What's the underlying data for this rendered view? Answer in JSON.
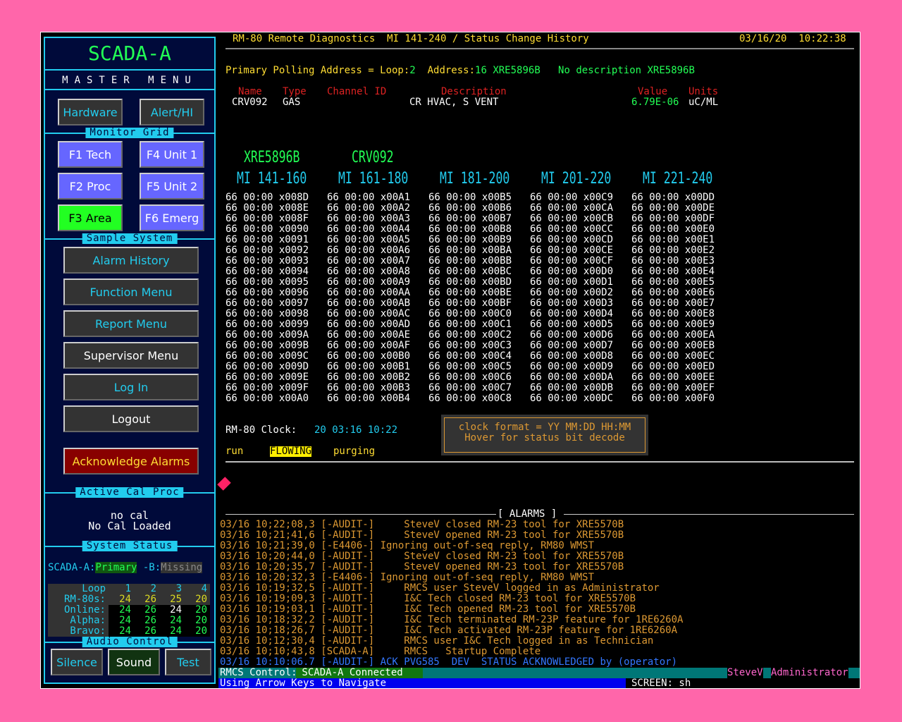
{
  "sidebar": {
    "title": "SCADA-A",
    "master_menu": "MASTER  MENU",
    "hardware": "Hardware",
    "alert": "Alert/HI",
    "monitor_grid": "Monitor Grid",
    "f1": "F1 Tech",
    "f4": "F4 Unit 1",
    "f2": "F2 Proc",
    "f5": "F5 Unit 2",
    "f3": "F3 Area",
    "f6": "F6 Emerg",
    "sample_system": "Sample System",
    "alarm_history": "Alarm History",
    "function_menu": "Function Menu",
    "report_menu": "Report Menu",
    "supervisor_menu": "Supervisor Menu",
    "log_in": "Log In",
    "logout": "Logout",
    "ack_alarms": "Acknowledge Alarms",
    "active_cal": "Active Cal Proc",
    "no_cal": "no cal",
    "no_cal_loaded": "No Cal Loaded",
    "system_status": "System  Status",
    "scada_a_label": "SCADA-A:",
    "primary": "Primary",
    "b_label": " -B:",
    "missing": "Missing",
    "status_table": {
      "header": [
        "Loop",
        "1",
        "2",
        "3",
        "4"
      ],
      "rows": [
        [
          "RM-80s:",
          "24",
          "26",
          "25",
          "20"
        ],
        [
          "Online:",
          "24",
          "26",
          "24",
          "20"
        ],
        [
          "Alpha:",
          "24",
          "26",
          "24",
          "20"
        ],
        [
          "Bravo:",
          "24",
          "26",
          "24",
          "20"
        ]
      ]
    },
    "audio_control": "Audio Control",
    "silence": "Silence",
    "sound": "Sound",
    "test": "Test"
  },
  "header": {
    "title": "RM-80 Remote Diagnostics  MI 141-240 / Status Change History",
    "datetime": "03/16/20  10:22:38"
  },
  "polling": {
    "label": "Primary Polling Address = Loop:",
    "loop": "2",
    "addr_label": "  Address:",
    "address": "16 XRE5896B",
    "desc": "No description XRE5896B"
  },
  "point": {
    "h_name": "Name",
    "h_type": "Type",
    "h_channel": "Channel ID",
    "h_desc": "Description",
    "h_value": "Value",
    "h_units": "Units",
    "name": "CRV092",
    "type": "GAS",
    "description": "CR HVAC, S VENT",
    "value": "6.79E-06",
    "units": "uC/ML"
  },
  "columns": {
    "dev1": "XRE5896B",
    "dev2": "CRV092",
    "c1": "MI 141-160",
    "c2": "MI 161-180",
    "c3": "MI 181-200",
    "c4": "MI 201-220",
    "c5": "MI 221-240"
  },
  "grid": {
    "col1": [
      "66 00:00 x008D",
      "66 00:00 x008E",
      "66 00:00 x008F",
      "66 00:00 x0090",
      "66 00:00 x0091",
      "66 00:00 x0092",
      "66 00:00 x0093",
      "66 00:00 x0094",
      "66 00:00 x0095",
      "66 00:00 x0096",
      "66 00:00 x0097",
      "66 00:00 x0098",
      "66 00:00 x0099",
      "66 00:00 x009A",
      "66 00:00 x009B",
      "66 00:00 x009C",
      "66 00:00 x009D",
      "66 00:00 x009E",
      "66 00:00 x009F",
      "66 00:00 x00A0"
    ],
    "col2": [
      "66 00:00 x00A1",
      "66 00:00 x00A2",
      "66 00:00 x00A3",
      "66 00:00 x00A4",
      "66 00:00 x00A5",
      "66 00:00 x00A6",
      "66 00:00 x00A7",
      "66 00:00 x00A8",
      "66 00:00 x00A9",
      "66 00:00 x00AA",
      "66 00:00 x00AB",
      "66 00:00 x00AC",
      "66 00:00 x00AD",
      "66 00:00 x00AE",
      "66 00:00 x00AF",
      "66 00:00 x00B0",
      "66 00:00 x00B1",
      "66 00:00 x00B2",
      "66 00:00 x00B3",
      "66 00:00 x00B4"
    ],
    "col3": [
      "66 00:00 x00B5",
      "66 00:00 x00B6",
      "66 00:00 x00B7",
      "66 00:00 x00B8",
      "66 00:00 x00B9",
      "66 00:00 x00BA",
      "66 00:00 x00BB",
      "66 00:00 x00BC",
      "66 00:00 x00BD",
      "66 00:00 x00BE",
      "66 00:00 x00BF",
      "66 00:00 x00C0",
      "66 00:00 x00C1",
      "66 00:00 x00C2",
      "66 00:00 x00C3",
      "66 00:00 x00C4",
      "66 00:00 x00C5",
      "66 00:00 x00C6",
      "66 00:00 x00C7",
      "66 00:00 x00C8"
    ],
    "col4": [
      "66 00:00 x00C9",
      "66 00:00 x00CA",
      "66 00:00 x00CB",
      "66 00:00 x00CC",
      "66 00:00 x00CD",
      "66 00:00 x00CE",
      "66 00:00 x00CF",
      "66 00:00 x00D0",
      "66 00:00 x00D1",
      "66 00:00 x00D2",
      "66 00:00 x00D3",
      "66 00:00 x00D4",
      "66 00:00 x00D5",
      "66 00:00 x00D6",
      "66 00:00 x00D7",
      "66 00:00 x00D8",
      "66 00:00 x00D9",
      "66 00:00 x00DA",
      "66 00:00 x00DB",
      "66 00:00 x00DC"
    ],
    "col5": [
      "66 00:00 x00DD",
      "66 00:00 x00DE",
      "66 00:00 x00DF",
      "66 00:00 x00E0",
      "66 00:00 x00E1",
      "66 00:00 x00E2",
      "66 00:00 x00E3",
      "66 00:00 x00E4",
      "66 00:00 x00E5",
      "66 00:00 x00E6",
      "66 00:00 x00E7",
      "66 00:00 x00E8",
      "66 00:00 x00E9",
      "66 00:00 x00EA",
      "66 00:00 x00EB",
      "66 00:00 x00EC",
      "66 00:00 x00ED",
      "66 00:00 x00EE",
      "66 00:00 x00EF",
      "66 00:00 x00F0"
    ]
  },
  "clock": {
    "label": "RM-80 Clock:",
    "value": "20 03:16 10:22",
    "tip1": "clock format = YY MM:DD HH:MM",
    "tip2": "Hover for status bit decode",
    "run": "run",
    "flowing": "FLOWING",
    "purging": "purging"
  },
  "alarms": {
    "title": "[ ALARMS ]",
    "lines": [
      "03/16 10;22;08,3 [-AUDIT-]     SteveV closed RM-23 tool for XRE5570B",
      "03/16 10;21;41,6 [-AUDIT-]     SteveV opened RM-23 tool for XRE5570B",
      "03/16 10;21;39,0 [-E4406-] Ignoring out-of-seq reply, RM80 WMST",
      "03/16 10;20;44,0 [-AUDIT-]     SteveV closed RM-23 tool for XRE5570B",
      "03/16 10;20;35,7 [-AUDIT-]     SteveV opened RM-23 tool for XRE5570B",
      "03/16 10;20;32,3 [-E4406-] Ignoring out-of-seq reply, RM80 WMST",
      "03/16 10;19;32,5 [-AUDIT-]     RMCS user SteveV logged in as Administrator",
      "03/16 10;19;09,3 [-AUDIT-]     I&C Tech closed RM-23 tool for XRE5570B",
      "03/16 10;19;03,1 [-AUDIT-]     I&C Tech opened RM-23 tool for XRE5570B",
      "03/16 10;18;32,2 [-AUDIT-]     I&C Tech terminated RM-23P feature for 1RE6260A",
      "03/16 10;18;26,7 [-AUDIT-]     I&C Tech activated RM-23P feature for 1RE6260A",
      "03/16 10;12;30,4 [-AUDIT-]     RMCS user I&C Tech logged in as Technician",
      "03/16 10;10;43,8 [SCADA-A]     RMCS   Startup Complete"
    ],
    "last_line": "03/16 10:10:06.7 [-AUDIT-] ACK PVG585  DEV  STATUS ACKNOWLEDGED by (operator)"
  },
  "statusbar": {
    "control_label": "RMCS Control:",
    "control_value": " SCADA-A Connected",
    "user": "SteveV",
    "role": "Administrator",
    "hint": "Using Arrow Keys to Navigate",
    "screen": "SCREEN: sh"
  }
}
